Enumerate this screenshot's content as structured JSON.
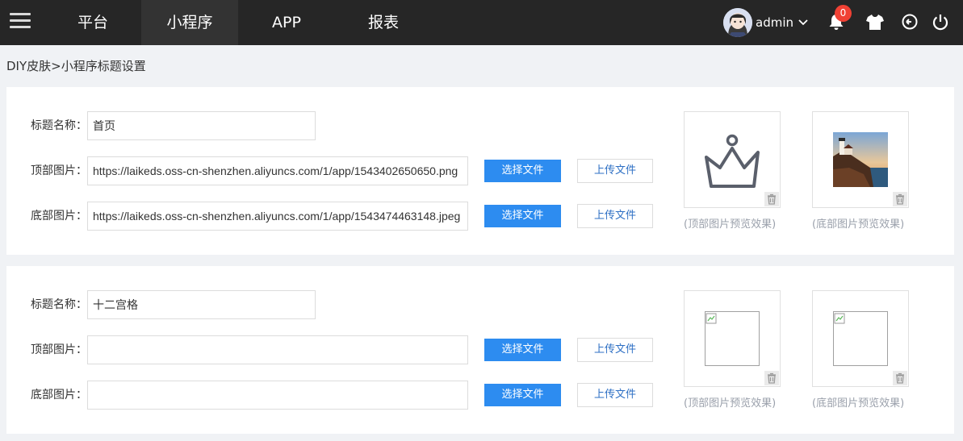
{
  "nav": {
    "tabs": [
      {
        "label": "平台",
        "active": false
      },
      {
        "label": "小程序",
        "active": true
      },
      {
        "label": "APP",
        "active": false
      },
      {
        "label": "报表",
        "active": false
      }
    ],
    "user": {
      "name": "admin"
    },
    "notifications": {
      "count": "0"
    },
    "icons": [
      "menu-icon",
      "bell-icon",
      "shirt-icon",
      "back-icon",
      "power-icon"
    ]
  },
  "breadcrumb": "DIY皮肤>小程序标题设置",
  "panels": [
    {
      "title_label": "标题名称：",
      "title_value": "首页",
      "top_label": "顶部图片：",
      "top_value": "https://laikeds.oss-cn-shenzhen.aliyuncs.com/1/app/1543402650650.png",
      "bottom_label": "底部图片：",
      "bottom_value": "https://laikeds.oss-cn-shenzhen.aliyuncs.com/1/app/1543474463148.jpeg",
      "select_label": "选择文件",
      "upload_label": "上传文件",
      "top_preview_caption": "(顶部图片预览效果)",
      "bottom_preview_caption": "(底部图片预览效果)"
    },
    {
      "title_label": "标题名称：",
      "title_value": "十二宫格",
      "top_label": "顶部图片：",
      "top_value": "",
      "bottom_label": "底部图片：",
      "bottom_value": "",
      "select_label": "选择文件",
      "upload_label": "上传文件",
      "top_preview_caption": "(顶部图片预览效果)",
      "bottom_preview_caption": "(底部图片预览效果)"
    }
  ],
  "colors": {
    "topbar": "#262626",
    "primary": "#2d8cf0",
    "badge": "#f04134"
  }
}
